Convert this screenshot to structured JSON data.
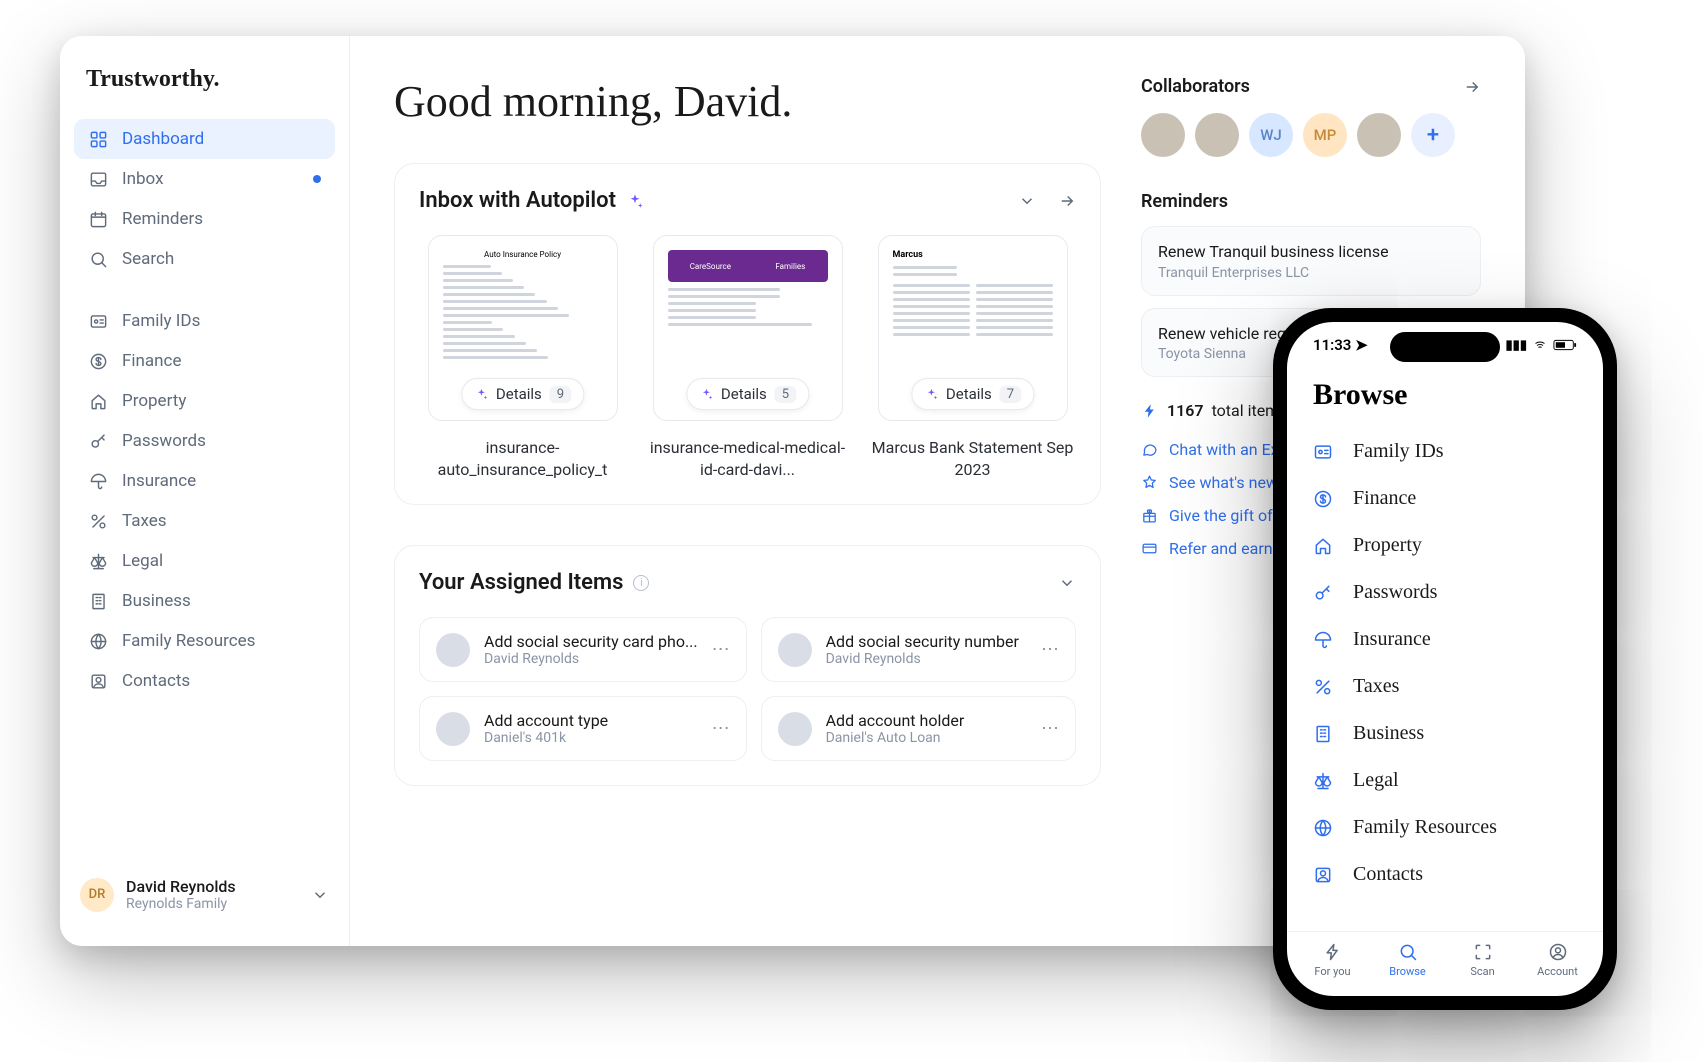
{
  "brand": "Trustworthy.",
  "greeting": "Good morning, David.",
  "sidebar": {
    "primary": [
      {
        "label": "Dashboard",
        "icon": "grid",
        "active": true
      },
      {
        "label": "Inbox",
        "icon": "tray",
        "dot": true
      },
      {
        "label": "Reminders",
        "icon": "calendar"
      },
      {
        "label": "Search",
        "icon": "search"
      }
    ],
    "secondary": [
      {
        "label": "Family IDs",
        "icon": "id-card"
      },
      {
        "label": "Finance",
        "icon": "dollar"
      },
      {
        "label": "Property",
        "icon": "home"
      },
      {
        "label": "Passwords",
        "icon": "key"
      },
      {
        "label": "Insurance",
        "icon": "umbrella"
      },
      {
        "label": "Taxes",
        "icon": "percent"
      },
      {
        "label": "Legal",
        "icon": "scale"
      },
      {
        "label": "Business",
        "icon": "building"
      },
      {
        "label": "Family Resources",
        "icon": "globe"
      },
      {
        "label": "Contacts",
        "icon": "contact"
      }
    ],
    "user": {
      "initials": "DR",
      "name": "David Reynolds",
      "family": "Reynolds Family"
    }
  },
  "inbox_panel": {
    "title": "Inbox with Autopilot",
    "details_label": "Details",
    "cards": [
      {
        "caption": "insurance-auto_insurance_policy_t",
        "count": "9",
        "variant": "text"
      },
      {
        "caption": "insurance-medical-medical-id-card-davi...",
        "count": "5",
        "variant": "card"
      },
      {
        "caption": "Marcus Bank Statement Sep 2023",
        "count": "7",
        "variant": "statement"
      }
    ]
  },
  "assigned_panel": {
    "title": "Your Assigned Items",
    "items": [
      {
        "title": "Add social security card pho...",
        "sub": "David Reynolds"
      },
      {
        "title": "Add social security number",
        "sub": "David Reynolds"
      },
      {
        "title": "Add account type",
        "sub": "Daniel's 401k"
      },
      {
        "title": "Add account holder",
        "sub": "Daniel's Auto Loan"
      }
    ]
  },
  "collaborators": {
    "title": "Collaborators",
    "items": [
      {
        "type": "photo"
      },
      {
        "type": "photo"
      },
      {
        "type": "initials",
        "text": "WJ",
        "class": "wj"
      },
      {
        "type": "initials",
        "text": "MP",
        "class": "mp"
      },
      {
        "type": "photo"
      }
    ]
  },
  "reminders": {
    "title": "Reminders",
    "items": [
      {
        "title": "Renew Tranquil business license",
        "sub": "Tranquil Enterprises LLC"
      },
      {
        "title": "Renew vehicle registration",
        "sub": "Toyota Sienna"
      }
    ]
  },
  "stat": {
    "count": "1167",
    "label": "total items added"
  },
  "links": [
    {
      "label": "Chat with an Expert",
      "icon": "chat"
    },
    {
      "label": "See what's new",
      "icon": "star"
    },
    {
      "label": "Give the gift of Trustworthy",
      "icon": "gift"
    },
    {
      "label": "Refer and earn",
      "icon": "card"
    }
  ],
  "phone": {
    "time": "11:33",
    "title": "Browse",
    "items": [
      {
        "label": "Family IDs",
        "icon": "id-card"
      },
      {
        "label": "Finance",
        "icon": "dollar"
      },
      {
        "label": "Property",
        "icon": "home"
      },
      {
        "label": "Passwords",
        "icon": "key"
      },
      {
        "label": "Insurance",
        "icon": "umbrella"
      },
      {
        "label": "Taxes",
        "icon": "percent"
      },
      {
        "label": "Business",
        "icon": "building"
      },
      {
        "label": "Legal",
        "icon": "scale"
      },
      {
        "label": "Family Resources",
        "icon": "globe"
      },
      {
        "label": "Contacts",
        "icon": "contact"
      }
    ],
    "tabs": [
      {
        "label": "For you",
        "icon": "bolt"
      },
      {
        "label": "Browse",
        "icon": "search",
        "active": true
      },
      {
        "label": "Scan",
        "icon": "scan"
      },
      {
        "label": "Account",
        "icon": "user"
      }
    ]
  }
}
